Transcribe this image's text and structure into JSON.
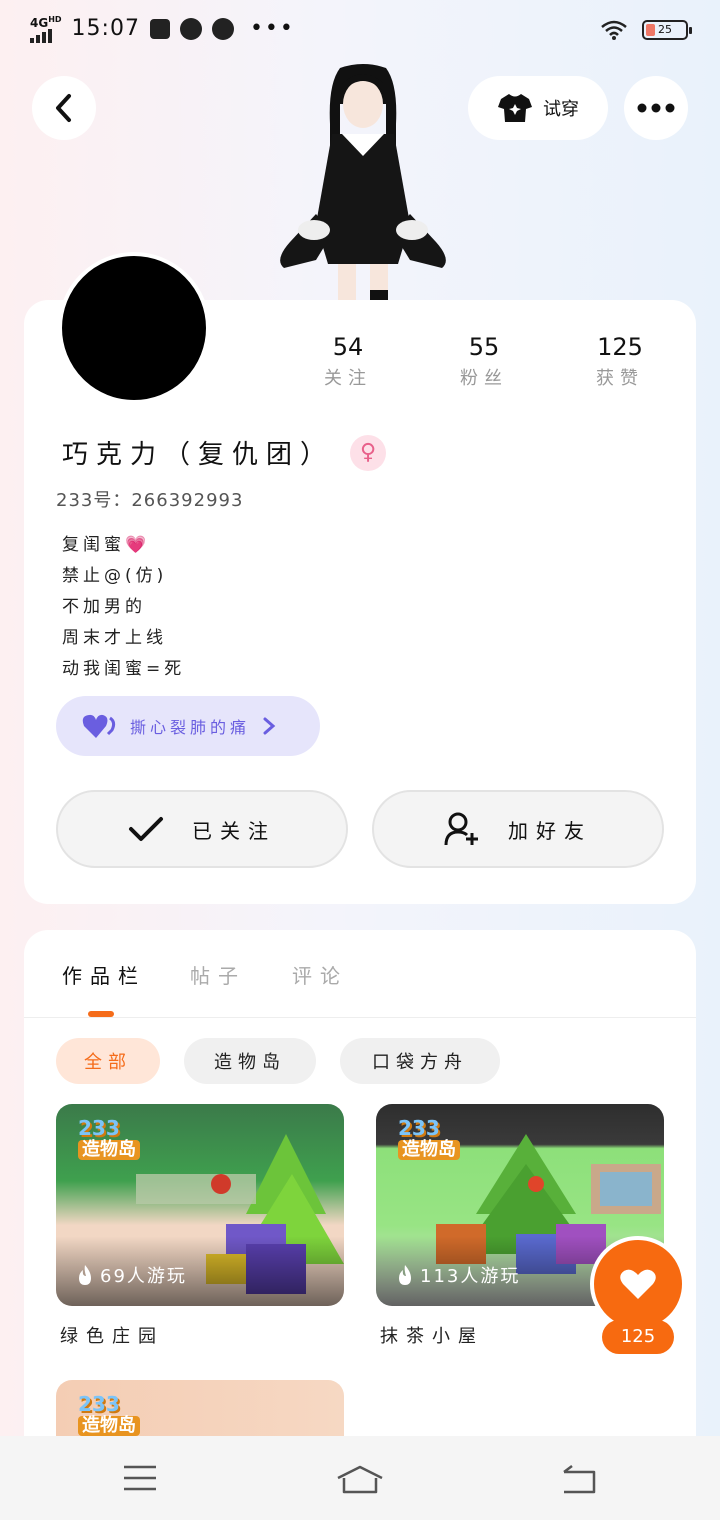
{
  "status_bar": {
    "network": "4G",
    "hd": "HD",
    "time": "15:07",
    "dots": "•••",
    "battery": "25"
  },
  "header": {
    "try_on_label": "试穿"
  },
  "profile": {
    "stats": [
      {
        "value": "54",
        "label": "关注"
      },
      {
        "value": "55",
        "label": "粉丝"
      },
      {
        "value": "125",
        "label": "获赞"
      }
    ],
    "name": "巧克力（复仇团）",
    "gender_symbol": "♀",
    "uid": "233号：266392993",
    "bio_lines": [
      "复闺蜜",
      "禁止@(仿)",
      "不加男的",
      "周末才上线",
      "动我闺蜜=死"
    ],
    "bio_heart": "💗",
    "nebula_label": "撕心裂肺的痛",
    "follow_button_label": "已关注",
    "add_friend_label": "加好友"
  },
  "works": {
    "tabs": [
      "作品栏",
      "帖子",
      "评论"
    ],
    "active_tab": 0,
    "chips": [
      "全部",
      "造物岛",
      "口袋方舟"
    ],
    "active_chip": 0,
    "games": [
      {
        "title": "绿色庄园",
        "plays": "69人游玩",
        "logo_top": "233",
        "logo_bottom": "造物岛"
      },
      {
        "title": "抹茶小屋",
        "plays": "113人游玩",
        "logo_top": "233",
        "logo_bottom": "造物岛"
      },
      {
        "title": "",
        "plays": "",
        "logo_top": "233",
        "logo_bottom": "造物岛"
      }
    ],
    "like_count": "125"
  }
}
